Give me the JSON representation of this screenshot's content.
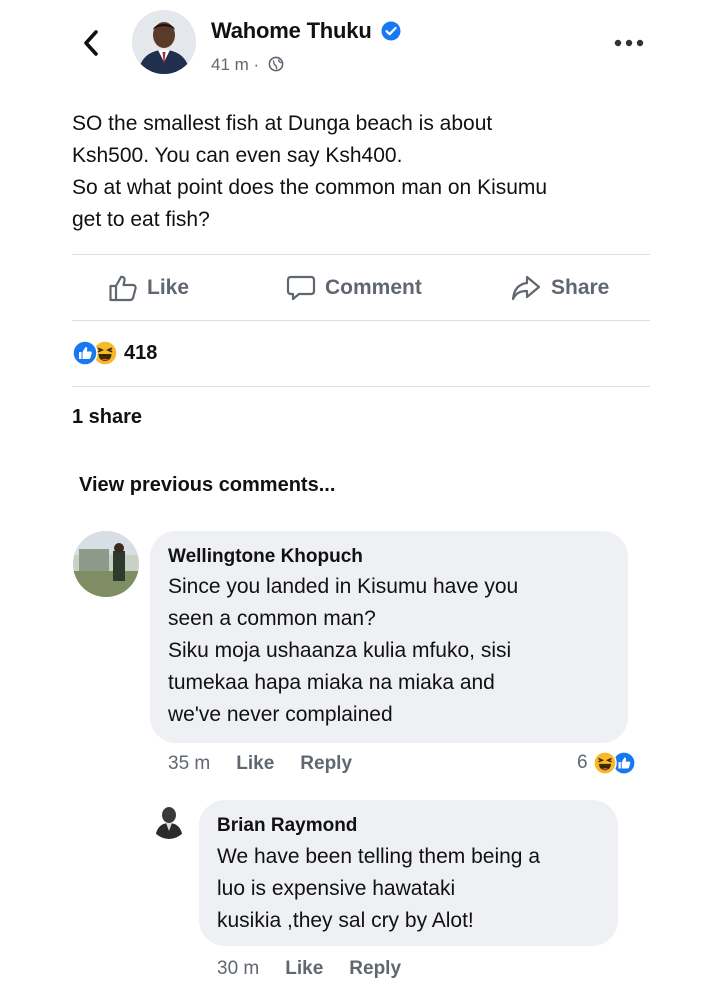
{
  "post": {
    "author": "Wahome Thuku",
    "time": "41 m",
    "separator": "·",
    "text": [
      "SO the smallest fish at Dunga beach is about",
      "Ksh500. You can even say Ksh400.",
      "So at what point does the common man on Kisumu",
      "get to eat fish?"
    ]
  },
  "actions": {
    "like": "Like",
    "comment": "Comment",
    "share": "Share"
  },
  "reactions": {
    "count": "418",
    "icons": [
      "like-icon",
      "haha-icon"
    ]
  },
  "shares": "1 share",
  "view_previous": "View previous comments...",
  "comments": [
    {
      "author": "Wellingtone Khopuch",
      "text": [
        "Since you landed in Kisumu have you",
        "seen a common man?",
        "Siku moja ushaanza kulia mfuko, sisi",
        "tumekaa hapa miaka na miaka and",
        "we've never complained"
      ],
      "time": "35 m",
      "like": "Like",
      "reply": "Reply",
      "reaction_count": "6",
      "reaction_icons": [
        "haha-icon",
        "like-icon"
      ]
    },
    {
      "author": "Brian Raymond",
      "text": [
        "We have been telling them being a",
        "luo is expensive hawataki",
        "kusikia ,they sal cry by Alot!"
      ],
      "time": "30 m",
      "like": "Like",
      "reply": "Reply"
    }
  ],
  "colors": {
    "like_blue": "#1877f2",
    "haha_yellow": "#f7b928",
    "bubble_bg": "#eef0f3",
    "muted_text": "#606770"
  }
}
